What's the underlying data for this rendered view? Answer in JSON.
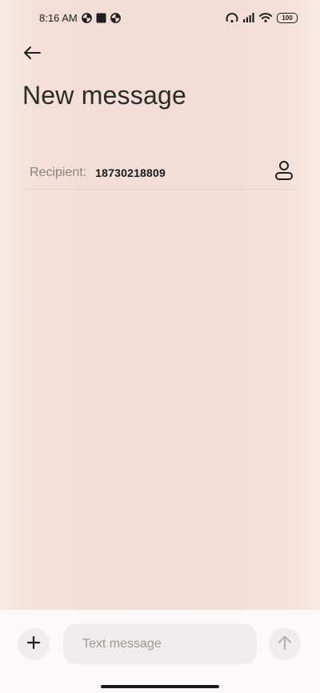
{
  "status_bar": {
    "time": "8:16 AM",
    "left_icons": [
      "notification-app-icon",
      "stop-square-icon",
      "notification-app-icon"
    ],
    "right_icons": [
      "hotspot-icon",
      "signal-icon",
      "wifi-icon"
    ],
    "battery": "100"
  },
  "header": {
    "back_icon": "arrow-left-icon",
    "title": "New message"
  },
  "recipient": {
    "label": "Recipient:",
    "number": "18730218809",
    "contact_icon": "person-icon"
  },
  "composer": {
    "add_icon": "plus-icon",
    "placeholder": "Text message",
    "value": "",
    "send_icon": "arrow-up-icon"
  },
  "colors": {
    "background": "#f2ddd6",
    "composer_bg": "#fbf8f7",
    "input_bg": "#efeceb",
    "text": "#1f1f1f",
    "muted": "#8a8380"
  }
}
